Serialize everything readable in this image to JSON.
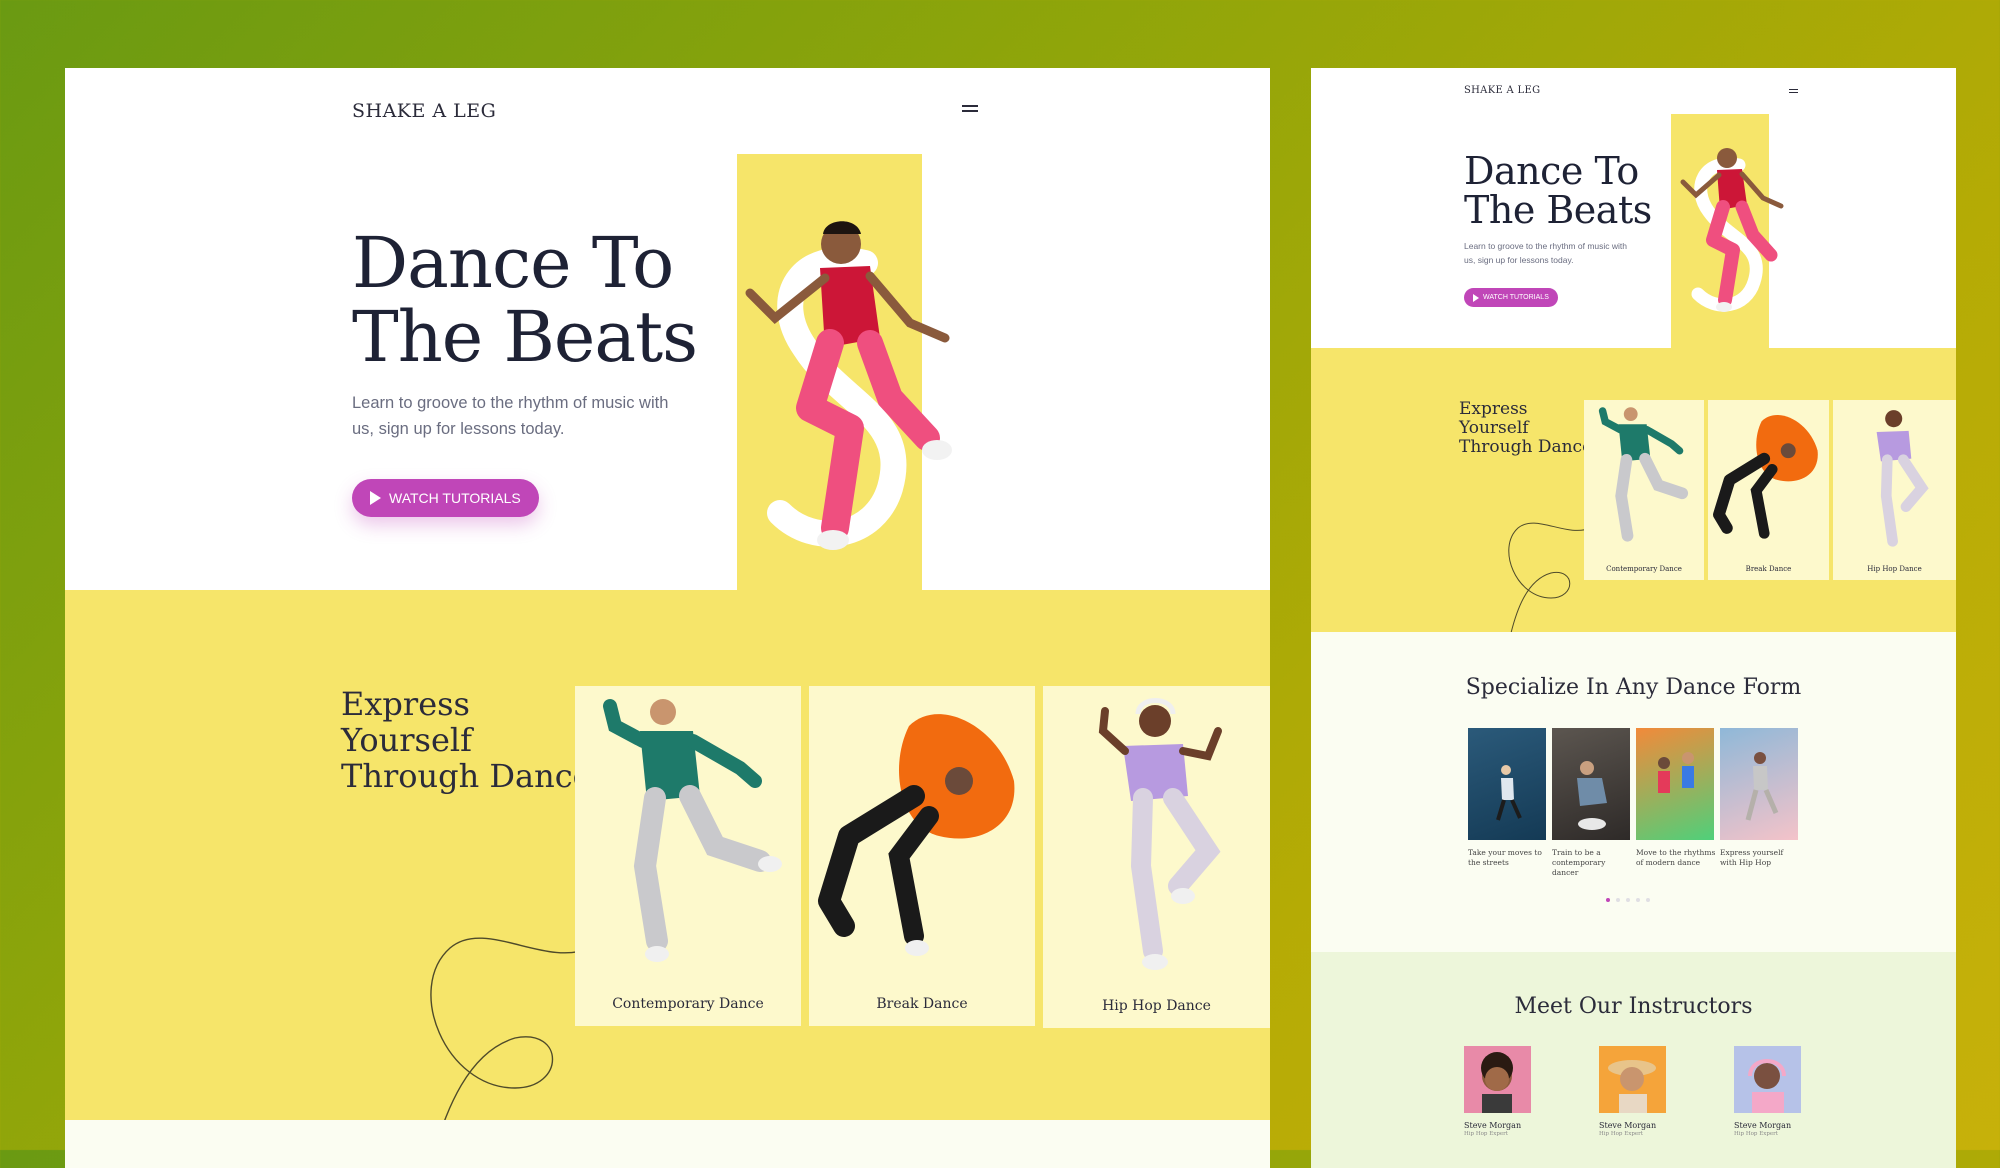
{
  "colors": {
    "accent": "#c046b8",
    "yellow": "#f6e56a",
    "card": "#fdf9cc",
    "text_dark": "#1e2235"
  },
  "desktop": {
    "logo": "SHAKE A LEG",
    "menu_icon": "hamburger-icon",
    "hero": {
      "title_line1": "Dance To",
      "title_line2": "The Beats",
      "description": "Learn to groove to the rhythm of music with us, sign up for lessons today.",
      "cta_label": "WATCH TUTORIALS"
    },
    "express": {
      "line1": "Express",
      "line2": "Yourself",
      "line3": "Through Dance",
      "cards": [
        {
          "label": "Contemporary Dance"
        },
        {
          "label": "Break Dance"
        },
        {
          "label": "Hip Hop Dance"
        }
      ]
    }
  },
  "mobile": {
    "logo": "SHAKE A LEG",
    "hero": {
      "title_line1": "Dance To",
      "title_line2": "The Beats",
      "description": "Learn to groove to the rhythm of music with us, sign up for lessons today.",
      "cta_label": "WATCH TUTORIALS"
    },
    "express": {
      "line1": "Express",
      "line2": "Yourself",
      "line3": "Through Dance",
      "cards": [
        {
          "label": "Contemporary Dance"
        },
        {
          "label": "Break Dance"
        },
        {
          "label": "Hip Hop Dance"
        }
      ]
    },
    "specialize": {
      "title": "Specialize In Any Dance Form",
      "items": [
        {
          "caption": "Take your moves to the streets"
        },
        {
          "caption": "Train to be a contemporary dancer"
        },
        {
          "caption": "Move to the rhythms of modern dance"
        },
        {
          "caption": "Express yourself with Hip Hop"
        }
      ],
      "dots": 5,
      "active_dot": 0
    },
    "instructors": {
      "title": "Meet Our Instructors",
      "people": [
        {
          "name": "Steve Morgan",
          "role": "Hip Hop Expert"
        },
        {
          "name": "Steve Morgan",
          "role": "Hip Hop Expert"
        },
        {
          "name": "Steve Morgan",
          "role": "Hip Hop Expert"
        }
      ]
    }
  }
}
